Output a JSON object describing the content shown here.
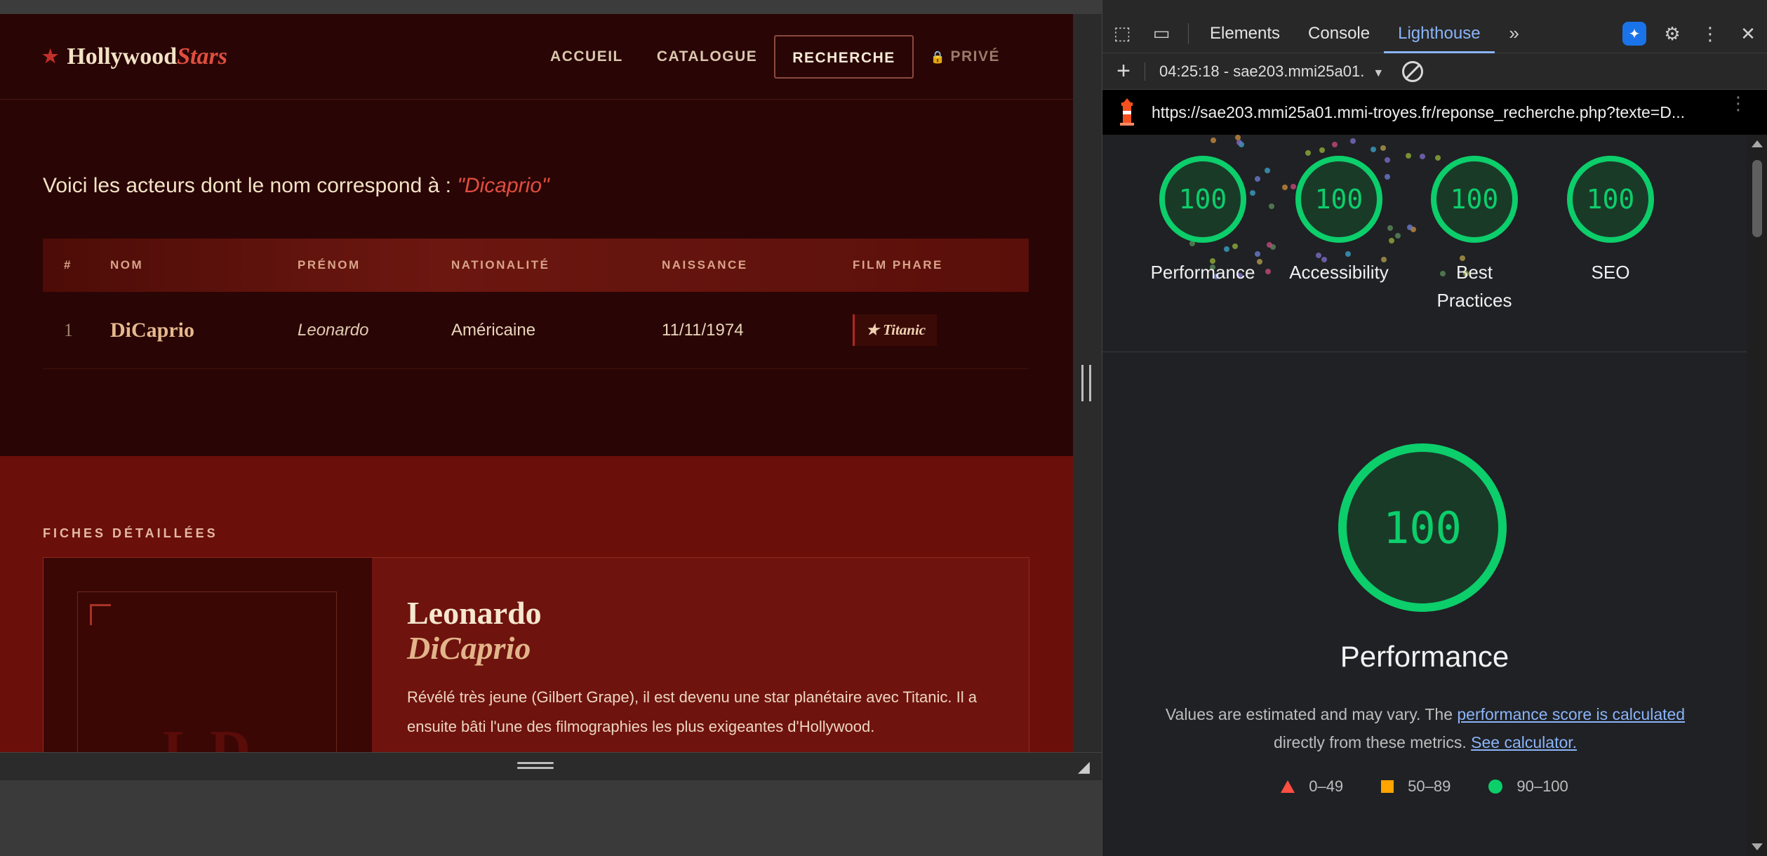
{
  "site": {
    "logo_main": "Hollywood",
    "logo_accent": "Stars",
    "nav": [
      "ACCUEIL",
      "CATALOGUE",
      "RECHERCHE",
      "PRIVÉ"
    ],
    "active_nav": "RECHERCHE",
    "intro_text": "Voici les acteurs dont le nom correspond à :",
    "query": "\"Dicaprio\"",
    "table": {
      "headers": [
        "#",
        "NOM",
        "PRÉNOM",
        "NATIONALITÉ",
        "NAISSANCE",
        "FILM PHARE"
      ],
      "rows": [
        {
          "num": "1",
          "nom": "DiCaprio",
          "prenom": "Leonardo",
          "nationalite": "Américaine",
          "naissance": "11/11/1974",
          "film": "★ Titanic"
        }
      ]
    },
    "fiches_title": "FICHES DÉTAILLÉES",
    "card": {
      "first_name": "Leonardo",
      "last_name": "DiCaprio",
      "initials": "LD",
      "bio": "Révélé très jeune (Gilbert Grape), il est devenu une star planétaire avec Titanic. Il a ensuite bâti l'une des filmographies les plus exigeantes d'Hollywood."
    }
  },
  "devtools": {
    "tabs": [
      "Elements",
      "Console",
      "Lighthouse"
    ],
    "active_tab": "Lighthouse",
    "report_label": "04:25:18 - sae203.mmi25a01.",
    "url": "https://sae203.mmi25a01.mmi-troyes.fr/reponse_recherche.php?texte=D...",
    "scores": [
      {
        "label": "Performance",
        "value": "100"
      },
      {
        "label": "Accessibility",
        "value": "100"
      },
      {
        "label": "Best Practices",
        "value": "100"
      },
      {
        "label": "SEO",
        "value": "100"
      }
    ],
    "main_score": "100",
    "main_title": "Performance",
    "desc_before": "Values are estimated and may vary. The",
    "desc_link1": "performance score is calculated",
    "desc_middle": "directly from these metrics.",
    "desc_link2": "See calculator.",
    "legend": [
      "0–49",
      "50–89",
      "90–100"
    ],
    "colors": {
      "pass": "#0cce6b",
      "average": "#ffa400",
      "fail": "#ff4e42",
      "accent": "#8ab4f8"
    }
  }
}
